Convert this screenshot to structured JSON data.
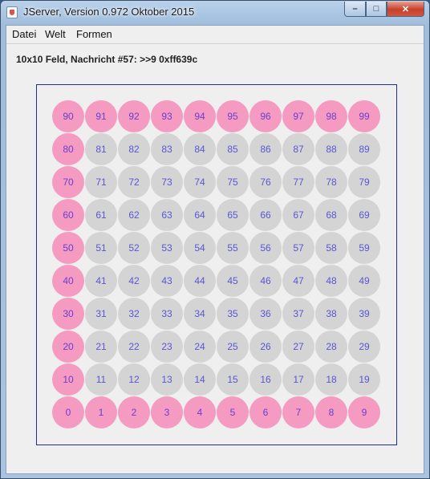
{
  "window": {
    "title": "JServer, Version 0.972 Oktober 2015",
    "controls": [
      "–",
      "□",
      "✕"
    ]
  },
  "menu": [
    "Datei",
    "Welt",
    "Formen"
  ],
  "message": "10x10 Feld, Nachricht #57: >>9 0xff639c",
  "board": {
    "cols": 10,
    "rows": 10,
    "highlight_color": "#f59ac1",
    "default_color": "#d4d4d4",
    "label_color": "#5a56d2",
    "border_color": "#1f2e9c",
    "highlighted": [
      0,
      1,
      2,
      3,
      4,
      5,
      6,
      7,
      8,
      9,
      10,
      20,
      30,
      40,
      50,
      60,
      70,
      80,
      90,
      91,
      92,
      93,
      94,
      95,
      96,
      97,
      98,
      99
    ]
  }
}
